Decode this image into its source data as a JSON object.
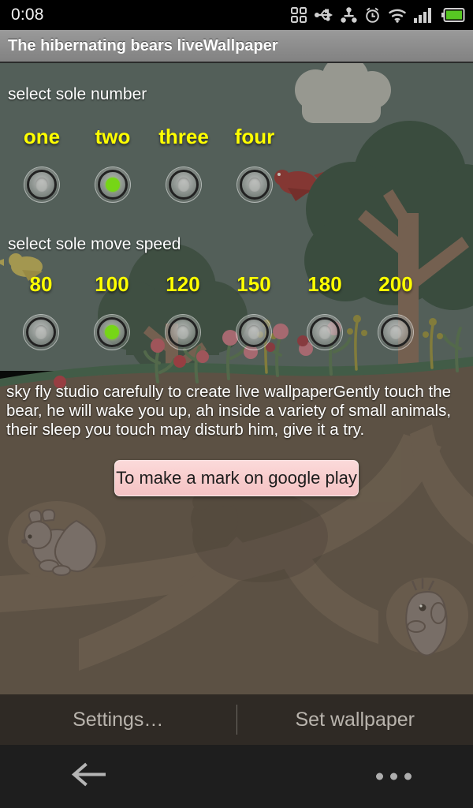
{
  "status_bar": {
    "clock": "0:08",
    "icons": [
      "apps-grid-icon",
      "usb-icon",
      "share-icon",
      "alarm-clock-icon",
      "wifi-icon",
      "signal-bars-icon",
      "battery-icon"
    ],
    "battery_color": "#57c723"
  },
  "title_bar": {
    "title": "The hibernating bears liveWallpaper"
  },
  "settings": {
    "sole_number": {
      "label": "select sole number",
      "options": [
        {
          "label": "one",
          "selected": false
        },
        {
          "label": "two",
          "selected": true
        },
        {
          "label": "three",
          "selected": false
        },
        {
          "label": "four",
          "selected": false
        }
      ]
    },
    "sole_move_speed": {
      "label": "select sole move speed",
      "options": [
        {
          "label": "80",
          "selected": false
        },
        {
          "label": "100",
          "selected": true
        },
        {
          "label": "120",
          "selected": false
        },
        {
          "label": "150",
          "selected": false
        },
        {
          "label": "180",
          "selected": false
        },
        {
          "label": "200",
          "selected": false
        }
      ]
    },
    "description": "sky fly studio carefully to create live wallpaperGently touch the bear, he will wake you up, ah inside a variety of small animals, their sleep you touch may disturb him, give it a try.",
    "mark_button": "To make a mark on google play"
  },
  "action_bar": {
    "settings_label": "Settings…",
    "set_wallpaper_label": "Set wallpaper"
  },
  "nav_bar": {
    "back": "back-arrow-icon",
    "more": "overflow-menu-icon"
  },
  "colors": {
    "selected_radio": "#76d616",
    "option_label": "#ffff00",
    "sky": "#5f6d67",
    "ground": "#6b5c4c",
    "tree_foliage": "#3f5545",
    "button_pink": "#f8cdcd"
  }
}
